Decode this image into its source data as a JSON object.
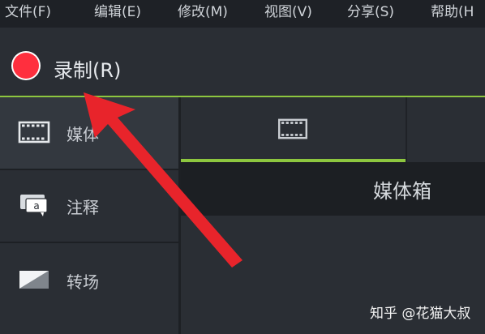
{
  "menu": {
    "file": "文件(F)",
    "edit": "编辑(E)",
    "modify": "修改(M)",
    "view": "视图(V)",
    "share": "分享(S)",
    "help": "帮助(H"
  },
  "record": {
    "label": "录制(R)",
    "dot_color": "#ff2f3e"
  },
  "sidebar": {
    "items": [
      {
        "label": "媒体",
        "icon": "film-icon",
        "active": true
      },
      {
        "label": "注释",
        "icon": "annotation-icon"
      },
      {
        "label": "转场",
        "icon": "transition-icon"
      }
    ]
  },
  "tabs": {
    "media_icon": "film-icon",
    "accent": "#8dc63f"
  },
  "media_bin": {
    "title": "媒体箱"
  },
  "watermark": "知乎 @花猫大叔",
  "annotation": {
    "arrow_color": "#e8242b"
  }
}
